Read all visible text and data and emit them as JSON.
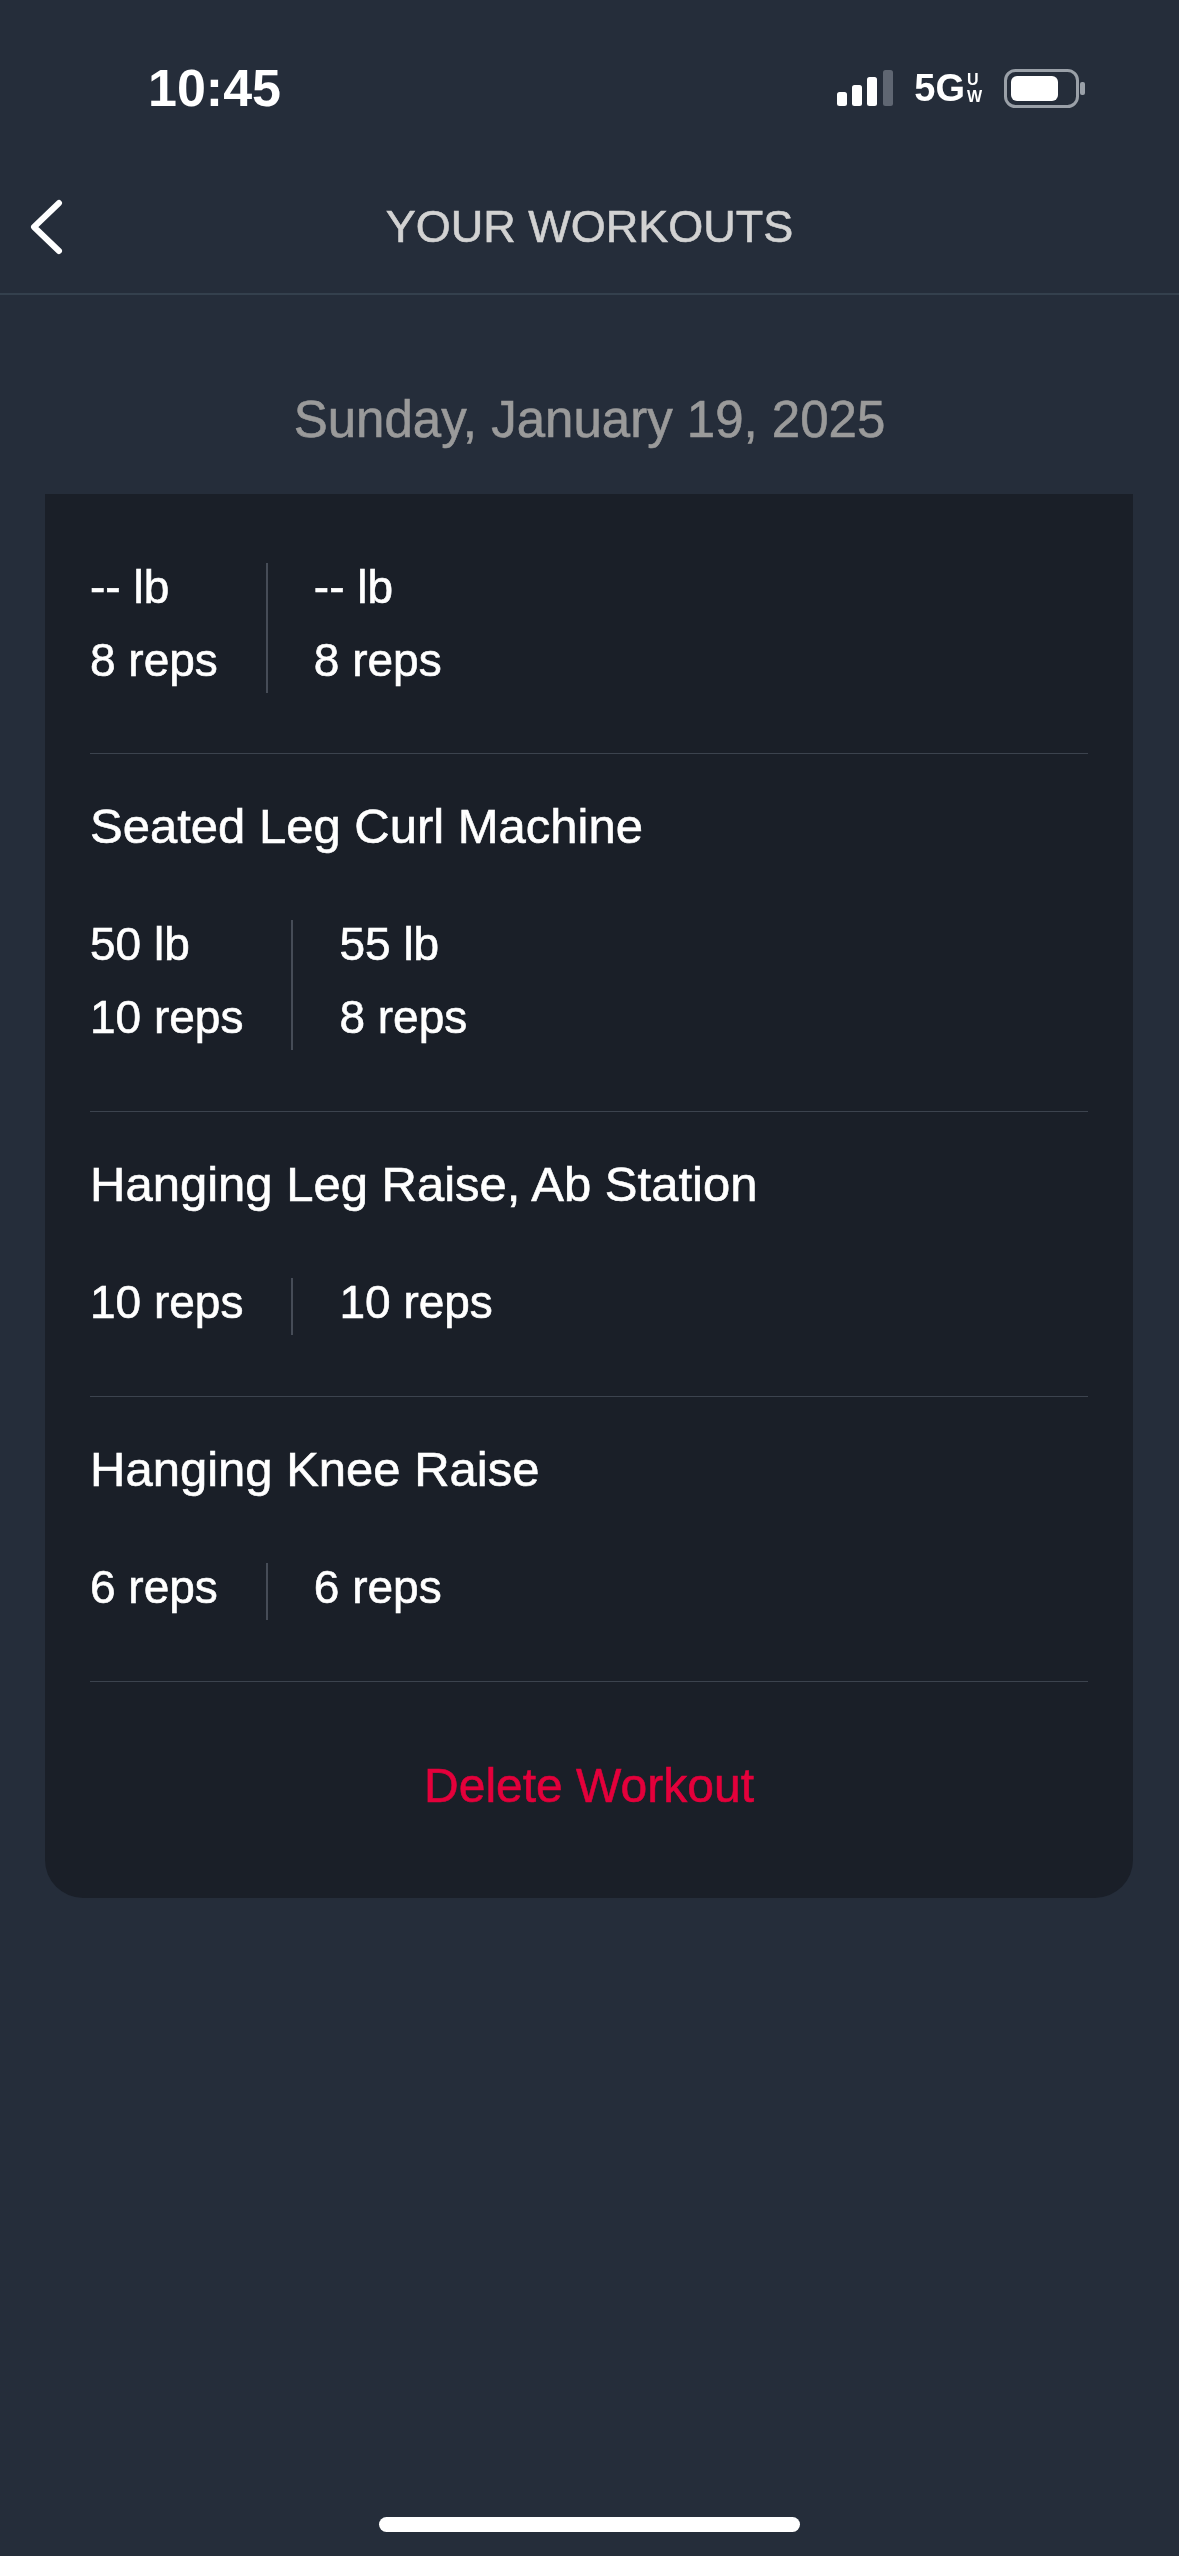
{
  "status_bar": {
    "time": "10:45",
    "network": "5G",
    "network_badge": "UW"
  },
  "nav_bar": {
    "title": "YOUR WORKOUTS"
  },
  "date": "Sunday, January 19, 2025",
  "exercises": [
    {
      "sets": [
        {
          "weight": "-- lb",
          "reps": "8 reps"
        },
        {
          "weight": "-- lb",
          "reps": "8 reps"
        }
      ]
    },
    {
      "name": "Seated Leg Curl Machine",
      "sets": [
        {
          "weight": "50 lb",
          "reps": "10 reps"
        },
        {
          "weight": "55 lb",
          "reps": "8 reps"
        }
      ]
    },
    {
      "name": "Hanging Leg Raise, Ab Station",
      "sets": [
        {
          "reps": "10 reps"
        },
        {
          "reps": "10 reps"
        }
      ]
    },
    {
      "name": "Hanging Knee Raise",
      "sets": [
        {
          "reps": "6 reps"
        },
        {
          "reps": "6 reps"
        }
      ]
    }
  ],
  "delete_button": {
    "label": "Delete Workout"
  }
}
